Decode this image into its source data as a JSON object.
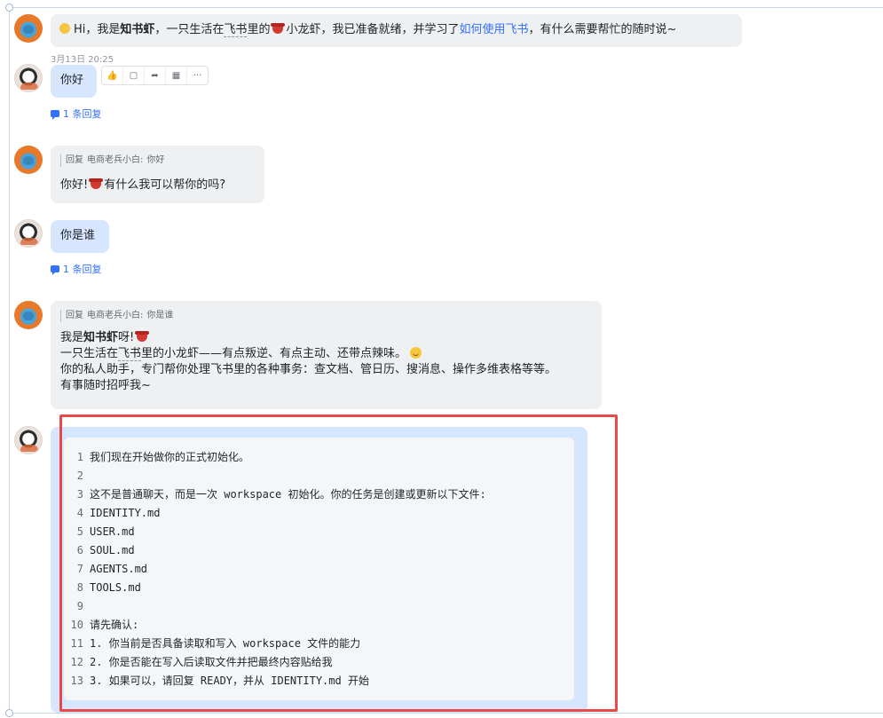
{
  "messages": {
    "bot_intro": {
      "prefix": "Hi，我是",
      "name": "知书虾",
      "mid1": "，一只生活在",
      "feishu": "飞书",
      "mid2": "里的",
      "mid3": "小龙虾，我已准备就绪，并学习了",
      "link": "如何使用飞书",
      "suffix": "，有什么需要帮忙的随时说~"
    },
    "user1": {
      "time": "3月13日 20:25",
      "text": "你好",
      "reply_count": "1 条回复"
    },
    "bot_reply1": {
      "quote_label": "回复",
      "quote_user": "电商老兵小白:",
      "quote_text": "你好",
      "text_a": "你好!",
      "text_b": "有什么我可以帮你的吗?"
    },
    "user2": {
      "text": "你是谁",
      "reply_count": "1 条回复"
    },
    "bot_reply2": {
      "quote_label": "回复",
      "quote_user": "电商老兵小白:",
      "quote_text": "你是谁",
      "line1_a": "我是",
      "line1_name": "知书虾",
      "line1_b": "呀!",
      "line2_a": "一只生活在",
      "line2_feishu": "飞书",
      "line2_b": "里的小龙虾——有点叛逆、有点主动、还带点辣味。",
      "line3": "你的私人助手，专门帮你处理飞书里的各种事务：查文档、管日历、搜消息、操作多维表格等等。",
      "line4": "有事随时招呼我~"
    },
    "user3": {
      "code_lines": [
        {
          "n": "1",
          "t": "我们现在开始做你的正式初始化。"
        },
        {
          "n": "2",
          "t": ""
        },
        {
          "n": "3",
          "t": "这不是普通聊天，而是一次 workspace 初始化。你的任务是创建或更新以下文件:"
        },
        {
          "n": "4",
          "t": "IDENTITY.md"
        },
        {
          "n": "5",
          "t": "USER.md"
        },
        {
          "n": "6",
          "t": "SOUL.md"
        },
        {
          "n": "7",
          "t": "AGENTS.md"
        },
        {
          "n": "8",
          "t": "TOOLS.md"
        },
        {
          "n": "9",
          "t": ""
        },
        {
          "n": "10",
          "t": "请先确认:"
        },
        {
          "n": "11",
          "t": "1. 你当前是否具备读取和写入 workspace 文件的能力"
        },
        {
          "n": "12",
          "t": "2. 你是否能在写入后读取文件并把最终内容贴给我"
        },
        {
          "n": "13",
          "t": "3. 如果可以，请回复 READY，并从 IDENTITY.md 开始"
        }
      ]
    }
  },
  "toolbar": {
    "icons": [
      "thumbs-up-icon",
      "comment-icon",
      "forward-icon",
      "pin-icon",
      "more-icon"
    ],
    "more_glyph": "···"
  },
  "colors": {
    "user_bubble": "#d7e6ff",
    "bot_bubble": "#eff0f1",
    "link": "#3370ff",
    "highlight": "#e84a4a"
  }
}
